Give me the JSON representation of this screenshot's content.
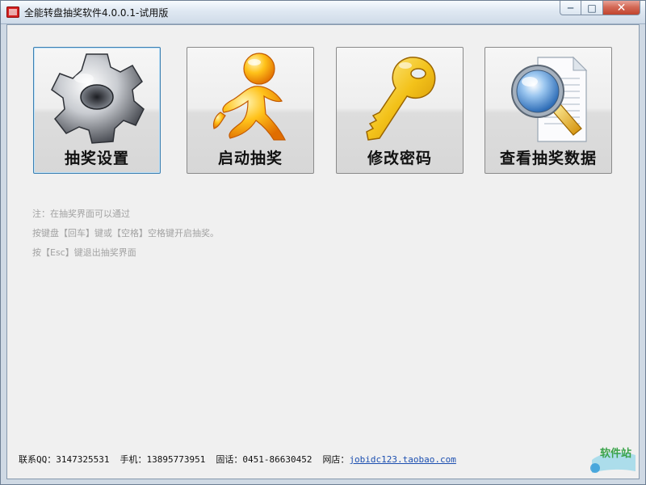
{
  "window": {
    "title": "全能转盘抽奖软件4.0.0.1-试用版",
    "buttons": {
      "minimize": "─",
      "maximize": "□",
      "close": "✕"
    }
  },
  "tiles": [
    {
      "id": "settings",
      "label": "抽奖设置",
      "icon": "gear-icon",
      "active": true
    },
    {
      "id": "start",
      "label": "启动抽奖",
      "icon": "running-man-icon",
      "active": false
    },
    {
      "id": "password",
      "label": "修改密码",
      "icon": "key-icon",
      "active": false
    },
    {
      "id": "data",
      "label": "查看抽奖数据",
      "icon": "magnifier-document-icon",
      "active": false
    }
  ],
  "notes": [
    "注：在抽奖界面可以通过",
    "按键盘【回车】键或【空格】空格键开启抽奖。",
    "按【Esc】键退出抽奖界面"
  ],
  "footer": {
    "qq": "联系QQ：3147325531",
    "phone": "手机：13895773951",
    "tel": "固话：0451-86630452",
    "shop_label": "网店：",
    "shop_link": "jobidc123.taobao.com"
  },
  "watermark": {
    "text": "软件站"
  },
  "colors": {
    "accent": "#3c7fb1",
    "link": "#1c4fb0",
    "note": "#a2a2a2"
  }
}
